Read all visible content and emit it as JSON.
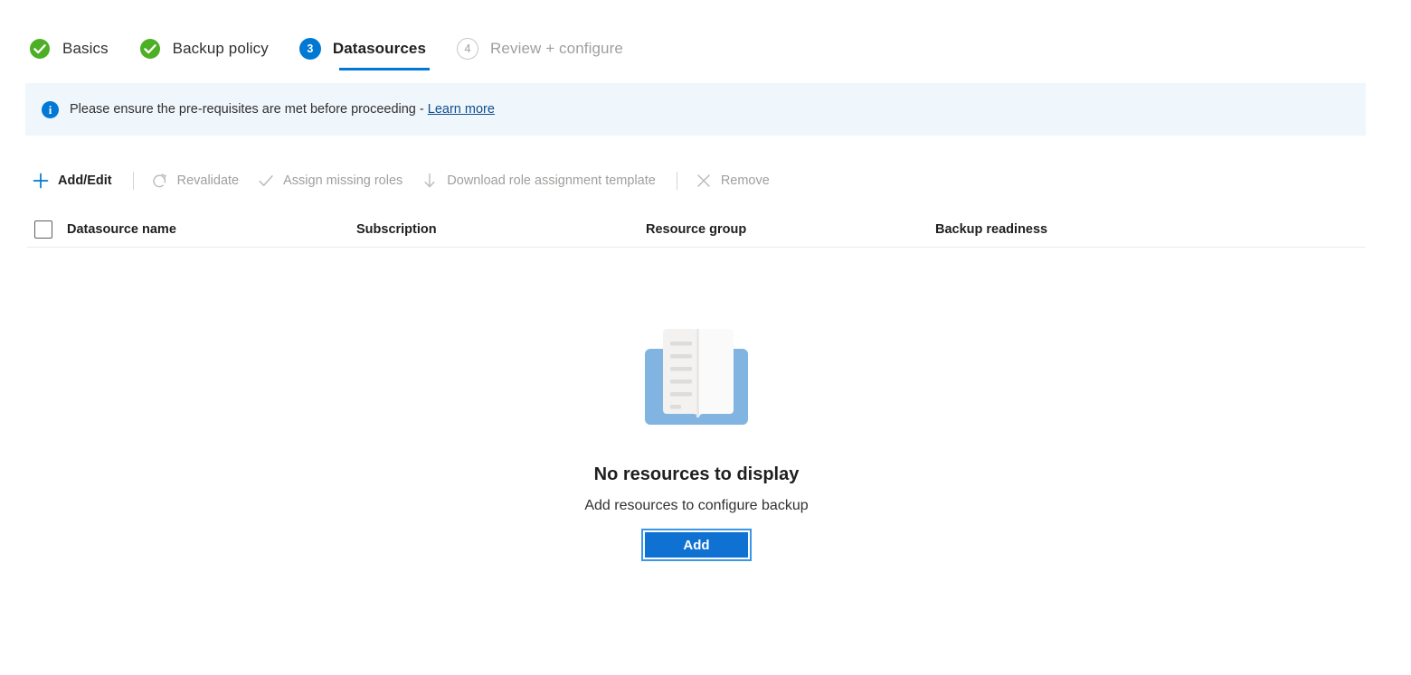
{
  "wizard": {
    "tabs": [
      {
        "label": "Basics",
        "state": "completed",
        "icon": "check-circle-icon",
        "step": "1"
      },
      {
        "label": "Backup policy",
        "state": "completed",
        "icon": "check-circle-icon",
        "step": "2"
      },
      {
        "label": "Datasources",
        "state": "active",
        "icon": "step-number-badge",
        "step": "3"
      },
      {
        "label": "Review + configure",
        "state": "disabled",
        "icon": "step-number-badge",
        "step": "4"
      }
    ]
  },
  "banner": {
    "icon": "info-icon",
    "glyph": "i",
    "text": "Please ensure the pre-requisites are met before proceeding - ",
    "link_label": "Learn more"
  },
  "toolbar": {
    "commands": [
      {
        "label": "Add/Edit",
        "icon": "plus-icon",
        "enabled": true
      },
      {
        "label": "Revalidate",
        "icon": "refresh-icon",
        "enabled": false
      },
      {
        "label": "Assign missing roles",
        "icon": "checkmark-icon",
        "enabled": false
      },
      {
        "label": "Download role assignment template",
        "icon": "download-arrow-icon",
        "enabled": false
      },
      {
        "label": "Remove",
        "icon": "close-x-icon",
        "enabled": false
      }
    ]
  },
  "grid": {
    "select_all_checkbox": "unchecked",
    "columns": [
      "Datasource name",
      "Subscription",
      "Resource group",
      "Backup readiness"
    ],
    "rows": []
  },
  "empty_state": {
    "illustration": "open-book-icon",
    "title": "No resources to display",
    "subtitle": "Add resources to configure backup",
    "button_label": "Add"
  },
  "colors": {
    "accent_blue": "#0078d4",
    "button_blue": "#0f72d3",
    "focus_ring_blue": "#3a96e8",
    "success_green": "#4caf24",
    "banner_background": "#eff6fc",
    "link_blue": "#0f4e8f",
    "disabled_gray": "#a19f9d",
    "book_cover_blue": "#81b4e0",
    "book_page_gray": "#f3f2f1"
  }
}
